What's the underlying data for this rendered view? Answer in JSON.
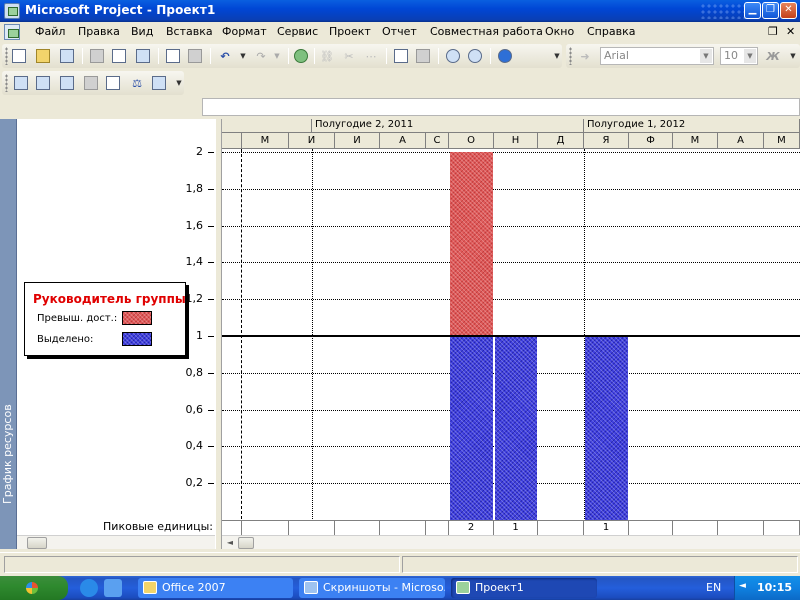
{
  "window": {
    "title": "Microsoft Project - Проект1"
  },
  "menu": {
    "items": [
      "Файл",
      "Правка",
      "Вид",
      "Вставка",
      "Формат",
      "Сервис",
      "Проект",
      "Отчет",
      "Совместная работа",
      "Окно",
      "Справка"
    ]
  },
  "toolbar": {
    "font_name": "Arial",
    "font_size": "10"
  },
  "view": {
    "side_label": "График ресурсов",
    "peak_label": "Пиковые единицы:"
  },
  "legend": {
    "title": "Руководитель группы",
    "overallocated_label": "Превыш. дост.:",
    "allocated_label": "Выделено:",
    "overallocated_color": "#e05a5a",
    "allocated_color": "#4040e0",
    "title_color": "#e00000"
  },
  "timescale": {
    "top_labels": [
      "",
      "Полугодие 2, 2011",
      "Полугодие 1, 2012"
    ],
    "months": [
      "М",
      "И",
      "И",
      "А",
      "С",
      "О",
      "Н",
      "Д",
      "Я",
      "Ф",
      "М",
      "А",
      "М"
    ]
  },
  "chart_data": {
    "type": "bar",
    "y_ticks": [
      "0,2",
      "0,4",
      "0,6",
      "0,8",
      "1",
      "1,2",
      "1,4",
      "1,6",
      "1,8",
      "2"
    ],
    "ylim": [
      0,
      2
    ],
    "categories": [
      "М",
      "И",
      "И",
      "А",
      "С",
      "О",
      "Н",
      "Д",
      "Я",
      "Ф",
      "М",
      "А",
      "М"
    ],
    "series": [
      {
        "name": "Выделено",
        "values": [
          0,
          0,
          0,
          0,
          0,
          1,
          1,
          0,
          1,
          0,
          0,
          0,
          0
        ]
      },
      {
        "name": "Превыш. дост.",
        "values": [
          0,
          0,
          0,
          0,
          0,
          1,
          0,
          0,
          0,
          0,
          0,
          0,
          0
        ]
      }
    ],
    "max_units": 1,
    "peak_units": [
      "",
      "",
      "",
      "",
      "",
      "2",
      "1",
      "",
      "1",
      "",
      "",
      "",
      ""
    ]
  },
  "taskbar": {
    "items": [
      "Office 2007",
      "Скриншоты - Microso...",
      "Проект1"
    ],
    "language": "EN",
    "clock": "10:15"
  }
}
